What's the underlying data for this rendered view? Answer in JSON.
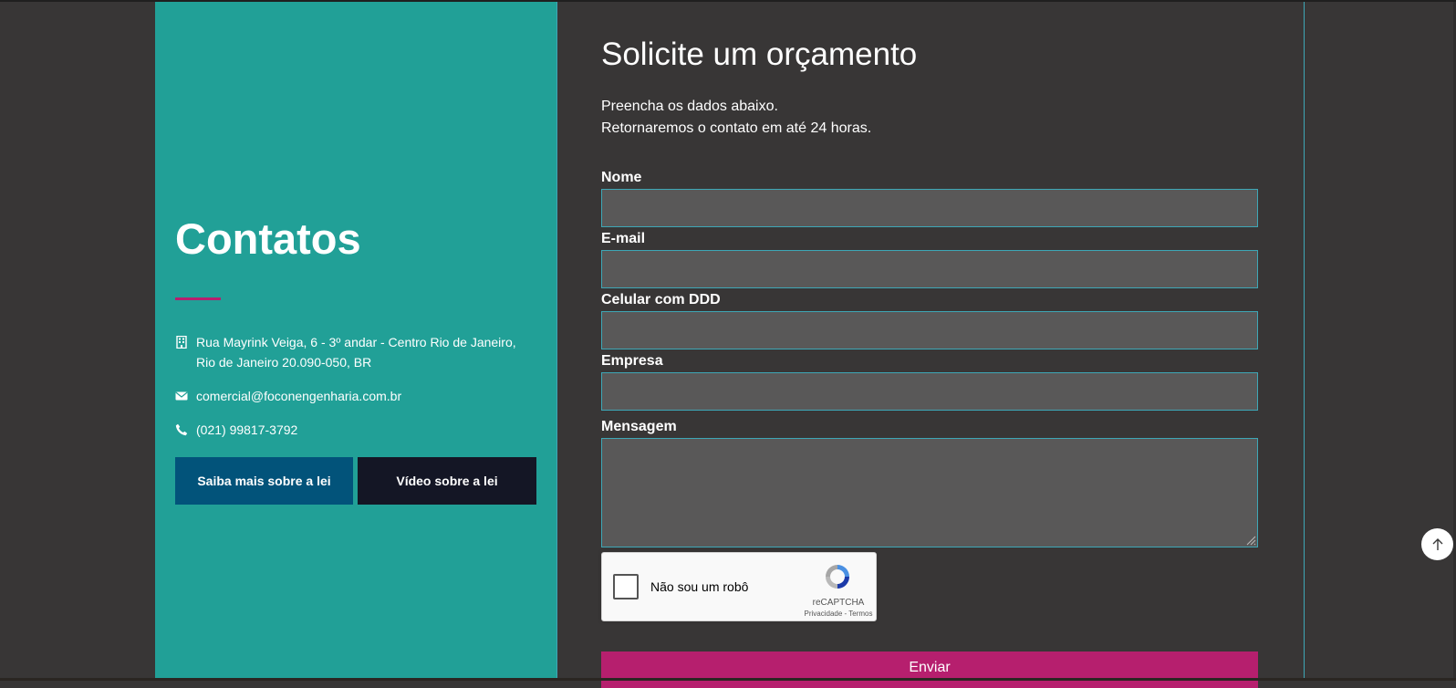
{
  "contacts": {
    "title": "Contatos",
    "address": "Rua Mayrink Veiga, 6 - 3º andar - Centro Rio de Janeiro, Rio de Janeiro 20.090-050, BR",
    "email": "comercial@foconengenharia.com.br",
    "phone": "(021) 99817-3792",
    "buttons": {
      "law": "Saiba mais sobre a lei",
      "video": "Vídeo sobre a lei"
    },
    "icons": {
      "address": "building-icon",
      "email": "envelope-icon",
      "phone": "phone-icon"
    }
  },
  "form": {
    "title": "Solicite um orçamento",
    "description_line1": "Preencha os dados abaixo.",
    "description_line2": "Retornaremos o contato em até 24 horas.",
    "fields": {
      "name": {
        "label": "Nome",
        "value": ""
      },
      "email": {
        "label": "E-mail",
        "value": ""
      },
      "phone": {
        "label": "Celular com DDD",
        "value": ""
      },
      "company": {
        "label": "Empresa",
        "value": ""
      },
      "message": {
        "label": "Mensagem",
        "value": ""
      }
    },
    "captcha": {
      "label": "Não sou um robô",
      "brand": "reCAPTCHA",
      "privacy": "Privacidade",
      "separator": "-",
      "terms": "Termos"
    },
    "submit": "Enviar"
  },
  "colors": {
    "background": "#383636",
    "teal_panel": "#21a097",
    "accent_magenta": "#b61f6e",
    "law_button": "#02537a",
    "video_button": "#141625",
    "input_background": "#595858",
    "input_border": "#3ea7b6"
  },
  "scroll_top_icon": "arrow-up-icon"
}
